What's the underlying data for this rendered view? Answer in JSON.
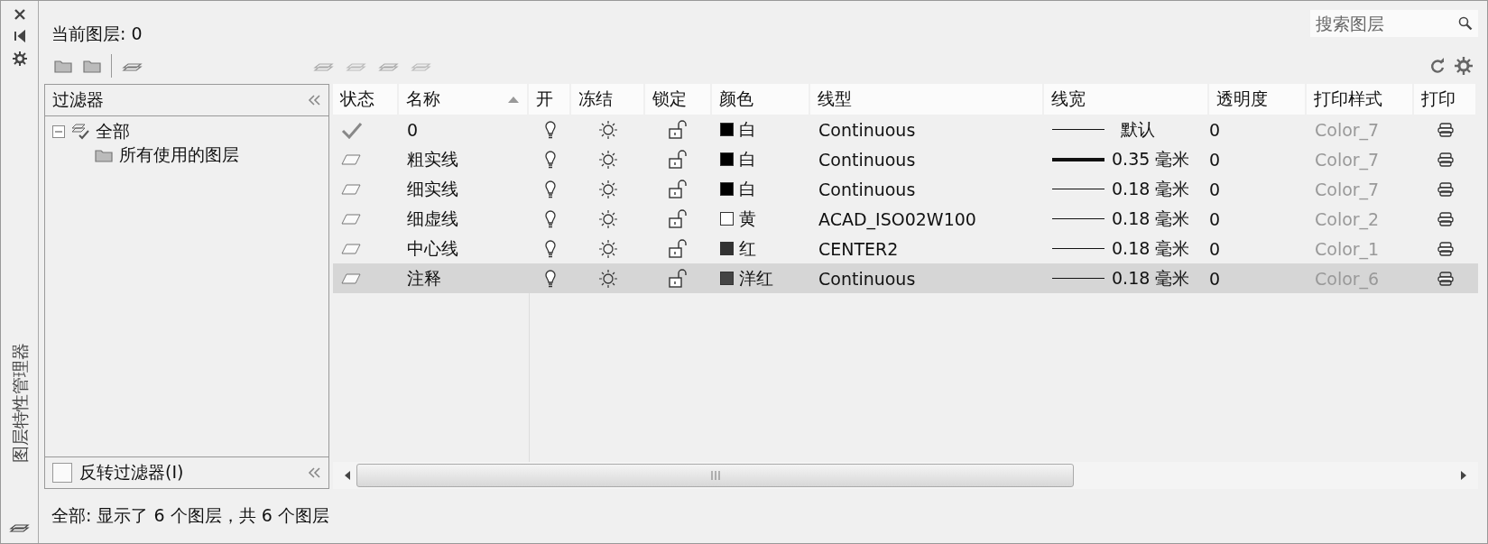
{
  "window": {
    "side_title": "图层特性管理器"
  },
  "current_layer": "当前图层: 0",
  "search": {
    "placeholder": "搜索图层"
  },
  "filters": {
    "title": "过滤器",
    "tree": [
      {
        "label": "全部",
        "kind": "all",
        "expanded": true,
        "children": [
          {
            "label": "所有使用的图层",
            "kind": "filter"
          }
        ]
      }
    ],
    "invert": {
      "label": "反转过滤器(I)",
      "checked": false
    }
  },
  "table": {
    "columns": [
      {
        "label": "状态",
        "sorted": false
      },
      {
        "label": "名称",
        "sorted": true
      },
      {
        "label": "开",
        "sorted": false
      },
      {
        "label": "冻结",
        "sorted": false
      },
      {
        "label": "锁定",
        "sorted": false
      },
      {
        "label": "颜色",
        "sorted": false
      },
      {
        "label": "线型",
        "sorted": false
      },
      {
        "label": "线宽",
        "sorted": false
      },
      {
        "label": "透明度",
        "sorted": false
      },
      {
        "label": "打印样式",
        "sorted": false
      },
      {
        "label": "打印",
        "sorted": false
      }
    ],
    "rows": [
      {
        "current": true,
        "name": "0",
        "on": true,
        "frozen": false,
        "locked": false,
        "color": "#000000",
        "color_name": "白",
        "linetype": "Continuous",
        "heavy": false,
        "lineweight": "默认",
        "transparency": "0",
        "plot_style": "Color_7",
        "plot": true,
        "selected": false
      },
      {
        "current": false,
        "name": "粗实线",
        "on": true,
        "frozen": false,
        "locked": false,
        "color": "#000000",
        "color_name": "白",
        "linetype": "Continuous",
        "heavy": true,
        "lineweight": "0.35 毫米",
        "transparency": "0",
        "plot_style": "Color_7",
        "plot": true,
        "selected": false
      },
      {
        "current": false,
        "name": "细实线",
        "on": true,
        "frozen": false,
        "locked": false,
        "color": "#000000",
        "color_name": "白",
        "linetype": "Continuous",
        "heavy": false,
        "lineweight": "0.18 毫米",
        "transparency": "0",
        "plot_style": "Color_7",
        "plot": true,
        "selected": false
      },
      {
        "current": false,
        "name": "细虚线",
        "on": true,
        "frozen": false,
        "locked": false,
        "color": "#ffffff",
        "color_name": "黄",
        "linetype": "ACAD_ISO02W100",
        "heavy": false,
        "lineweight": "0.18 毫米",
        "transparency": "0",
        "plot_style": "Color_2",
        "plot": true,
        "selected": false
      },
      {
        "current": false,
        "name": "中心线",
        "on": true,
        "frozen": false,
        "locked": false,
        "color": "#333333",
        "color_name": "红",
        "linetype": "CENTER2",
        "heavy": false,
        "lineweight": "0.18 毫米",
        "transparency": "0",
        "plot_style": "Color_1",
        "plot": true,
        "selected": false
      },
      {
        "current": false,
        "name": "注释",
        "on": true,
        "frozen": false,
        "locked": false,
        "color": "#444444",
        "color_name": "洋红",
        "linetype": "Continuous",
        "heavy": false,
        "lineweight": "0.18 毫米",
        "transparency": "0",
        "plot_style": "Color_6",
        "plot": true,
        "selected": true
      }
    ]
  },
  "status_bar": "全部: 显示了 6 个图层，共 6 个图层"
}
